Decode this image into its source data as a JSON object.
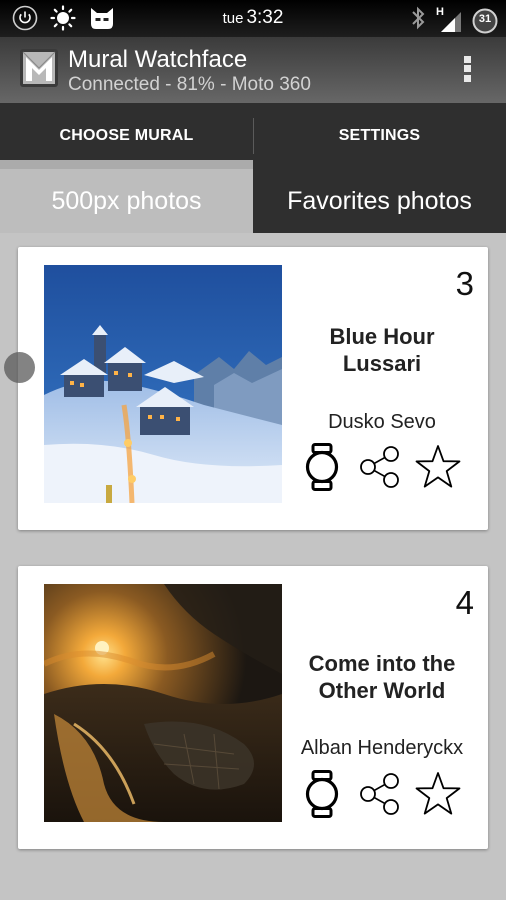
{
  "status_bar": {
    "day": "tue",
    "time": "3:32",
    "network_type": "H",
    "notification_count": "31",
    "icons": [
      "power-icon",
      "weather-sun-icon",
      "cyanogen-mascot-icon",
      "bluetooth-icon",
      "signal-icon"
    ]
  },
  "app": {
    "title": "Mural Watchface",
    "subtitle": "Connected - 81% - Moto 360",
    "logo_icon": "mural-logo-icon",
    "menu_icon": "overflow-menu-icon"
  },
  "tabs": [
    {
      "label": "CHOOSE MURAL",
      "selected": true
    },
    {
      "label": "SETTINGS",
      "selected": false
    }
  ],
  "subtabs": [
    {
      "label": "500px photos",
      "selected": true
    },
    {
      "label": "Favorites photos",
      "selected": false
    }
  ],
  "photos": [
    {
      "rank": "3",
      "title": "Blue Hour Lussari",
      "author": "Dusko Sevo",
      "actions": [
        "watch-icon",
        "share-icon",
        "star-icon"
      ]
    },
    {
      "rank": "4",
      "title": "Come into the Other World",
      "author": "Alban Henderyckx",
      "actions": [
        "watch-icon",
        "share-icon",
        "star-icon"
      ]
    }
  ],
  "colors": {
    "action_bar": "#555555",
    "tab_bar": "#2f2f2f",
    "selected_subtab": "#bdbdbd",
    "list_background": "#c4c4c4",
    "card": "#ffffff"
  }
}
